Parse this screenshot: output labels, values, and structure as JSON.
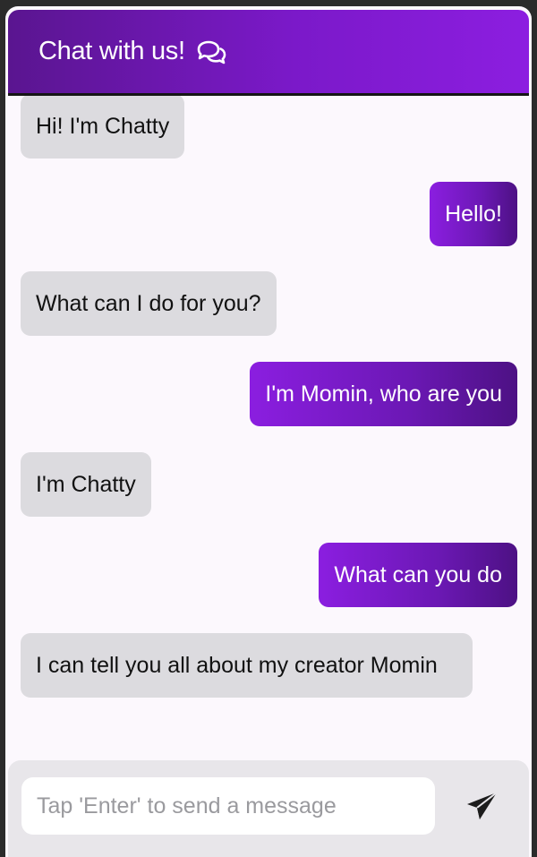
{
  "header": {
    "title": "Chat with us!",
    "icon": "chat-bubbles-icon"
  },
  "messages": [
    {
      "sender": "bot",
      "text": "Hi! I'm Chatty"
    },
    {
      "sender": "user",
      "text": "Hello!"
    },
    {
      "sender": "bot",
      "text": "What can I do for you?"
    },
    {
      "sender": "user",
      "text": "I'm Momin, who are you"
    },
    {
      "sender": "bot",
      "text": "I'm Chatty"
    },
    {
      "sender": "user",
      "text": "What can you do"
    },
    {
      "sender": "bot",
      "text": "I can tell you all about my creator Momin"
    }
  ],
  "composer": {
    "placeholder": "Tap 'Enter' to send a message",
    "value": "",
    "send_icon": "paper-plane-icon"
  },
  "colors": {
    "header_gradient_start": "#5a1590",
    "header_gradient_end": "#8c1ee0",
    "user_bubble": "#7b19c9",
    "bot_bubble": "#dcdbdf",
    "chat_background": "#fcf8fd"
  }
}
